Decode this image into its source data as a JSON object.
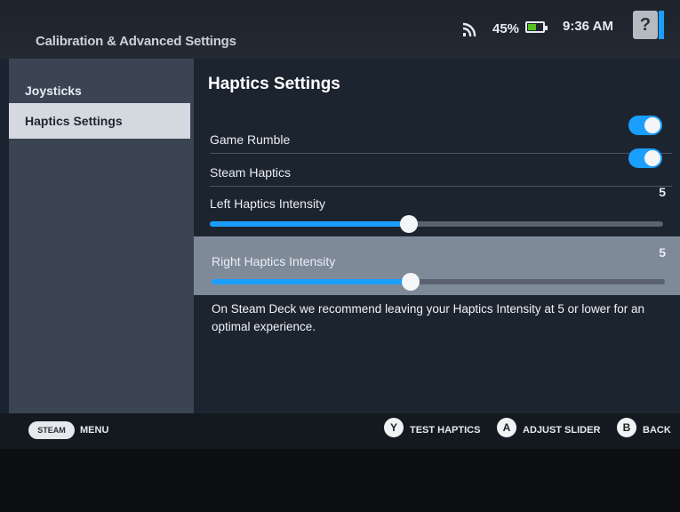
{
  "status": {
    "battery_percent": "45%",
    "time": "9:36 AM",
    "help_label": "?"
  },
  "app_title": "Calibration & Advanced Settings",
  "sidebar": {
    "items": [
      {
        "label": "Joysticks",
        "active": false
      },
      {
        "label": "Haptics Settings",
        "active": true
      }
    ]
  },
  "main": {
    "title": "Haptics Settings",
    "game_rumble": {
      "label": "Game Rumble",
      "enabled": true
    },
    "steam_haptics": {
      "label": "Steam Haptics",
      "enabled": true
    },
    "left_intensity": {
      "label": "Left Haptics Intensity",
      "value": "5",
      "fraction": 0.44
    },
    "right_intensity": {
      "label": "Right Haptics Intensity",
      "value": "5",
      "fraction": 0.44
    },
    "note": "On Steam Deck we recommend leaving your Haptics Intensity at 5 or lower for an optimal experience."
  },
  "bottom_bar": {
    "steam_label": "STEAM",
    "menu_label": "MENU",
    "y_button": "Y",
    "test_haptics": "TEST HAPTICS",
    "a_button": "A",
    "adjust_slider": "ADJUST SLIDER",
    "b_button": "B",
    "back": "BACK"
  },
  "colors": {
    "accent": "#1a9fff",
    "battery": "#55c21f"
  }
}
